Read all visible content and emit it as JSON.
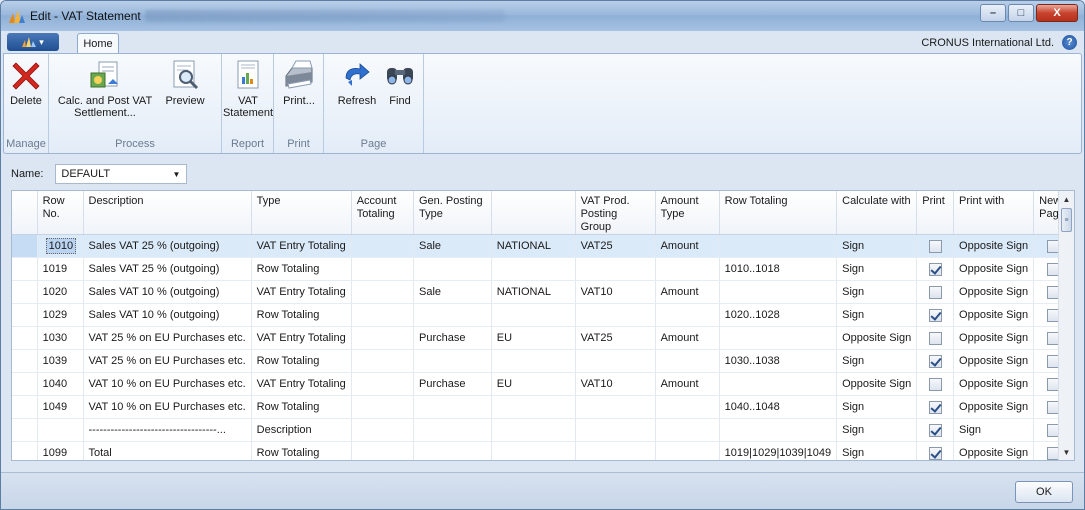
{
  "window": {
    "title": "Edit - VAT Statement",
    "min": "–",
    "max": "□",
    "close": "X"
  },
  "ribbon": {
    "app_button": "▾",
    "tab_home": "Home",
    "company": "CRONUS International Ltd.",
    "help": "?",
    "groups": {
      "manage": "Manage",
      "process": "Process",
      "report": "Report",
      "print": "Print",
      "page": "Page"
    },
    "buttons": {
      "delete": "Delete",
      "calc_post_1": "Calc. and Post VAT",
      "calc_post_2": "Settlement...",
      "preview": "Preview",
      "vat_statement_1": "VAT",
      "vat_statement_2": "Statement",
      "print": "Print...",
      "refresh": "Refresh",
      "find": "Find"
    }
  },
  "name_field": {
    "label": "Name:",
    "value": "DEFAULT"
  },
  "grid": {
    "headers": [
      "Row No.",
      "Description",
      "Type",
      "Account Totaling",
      "Gen. Posting Type",
      "",
      "VAT Prod. Posting Group",
      "Amount Type",
      "Row Totaling",
      "Calculate with",
      "Print",
      "Print with",
      "New Page"
    ],
    "rows": [
      {
        "row_no": "1010",
        "description": "Sales VAT 25 % (outgoing)",
        "type": "VAT Entry Totaling",
        "account_totaling": "",
        "gen_posting_type": "Sale",
        "bus_posting_group": "NATIONAL",
        "vat_prod_group": "VAT25",
        "amount_type": "Amount",
        "row_totaling": "",
        "calculate_with": "Sign",
        "print": false,
        "print_with": "Opposite Sign",
        "new_page": false
      },
      {
        "row_no": "1019",
        "description": "Sales VAT 25 % (outgoing)",
        "type": "Row Totaling",
        "account_totaling": "",
        "gen_posting_type": "",
        "bus_posting_group": "",
        "vat_prod_group": "",
        "amount_type": "",
        "row_totaling": "1010..1018",
        "calculate_with": "Sign",
        "print": true,
        "print_with": "Opposite Sign",
        "new_page": false
      },
      {
        "row_no": "1020",
        "description": "Sales VAT 10 % (outgoing)",
        "type": "VAT Entry Totaling",
        "account_totaling": "",
        "gen_posting_type": "Sale",
        "bus_posting_group": "NATIONAL",
        "vat_prod_group": "VAT10",
        "amount_type": "Amount",
        "row_totaling": "",
        "calculate_with": "Sign",
        "print": false,
        "print_with": "Opposite Sign",
        "new_page": false
      },
      {
        "row_no": "1029",
        "description": "Sales VAT 10 % (outgoing)",
        "type": "Row Totaling",
        "account_totaling": "",
        "gen_posting_type": "",
        "bus_posting_group": "",
        "vat_prod_group": "",
        "amount_type": "",
        "row_totaling": "1020..1028",
        "calculate_with": "Sign",
        "print": true,
        "print_with": "Opposite Sign",
        "new_page": false
      },
      {
        "row_no": "1030",
        "description": "VAT 25 % on EU Purchases etc.",
        "type": "VAT Entry Totaling",
        "account_totaling": "",
        "gen_posting_type": "Purchase",
        "bus_posting_group": "EU",
        "vat_prod_group": "VAT25",
        "amount_type": "Amount",
        "row_totaling": "",
        "calculate_with": "Opposite Sign",
        "print": false,
        "print_with": "Opposite Sign",
        "new_page": false
      },
      {
        "row_no": "1039",
        "description": "VAT 25 % on EU Purchases etc.",
        "type": "Row Totaling",
        "account_totaling": "",
        "gen_posting_type": "",
        "bus_posting_group": "",
        "vat_prod_group": "",
        "amount_type": "",
        "row_totaling": "1030..1038",
        "calculate_with": "Sign",
        "print": true,
        "print_with": "Opposite Sign",
        "new_page": false
      },
      {
        "row_no": "1040",
        "description": "VAT 10 % on EU Purchases etc.",
        "type": "VAT Entry Totaling",
        "account_totaling": "",
        "gen_posting_type": "Purchase",
        "bus_posting_group": "EU",
        "vat_prod_group": "VAT10",
        "amount_type": "Amount",
        "row_totaling": "",
        "calculate_with": "Opposite Sign",
        "print": false,
        "print_with": "Opposite Sign",
        "new_page": false
      },
      {
        "row_no": "1049",
        "description": "VAT 10 % on EU Purchases etc.",
        "type": "Row Totaling",
        "account_totaling": "",
        "gen_posting_type": "",
        "bus_posting_group": "",
        "vat_prod_group": "",
        "amount_type": "",
        "row_totaling": "1040..1048",
        "calculate_with": "Sign",
        "print": true,
        "print_with": "Opposite Sign",
        "new_page": false
      },
      {
        "row_no": "",
        "description": "-----------------------------------...",
        "type": "Description",
        "account_totaling": "",
        "gen_posting_type": "",
        "bus_posting_group": "",
        "vat_prod_group": "",
        "amount_type": "",
        "row_totaling": "",
        "calculate_with": "Sign",
        "print": true,
        "print_with": "Sign",
        "new_page": false
      },
      {
        "row_no": "1099",
        "description": "Total",
        "type": "Row Totaling",
        "account_totaling": "",
        "gen_posting_type": "",
        "bus_posting_group": "",
        "vat_prod_group": "",
        "amount_type": "",
        "row_totaling": "1019|1029|1039|1049",
        "calculate_with": "Sign",
        "print": true,
        "print_with": "Opposite Sign",
        "new_page": false
      }
    ],
    "selected_row": 0,
    "scroll_up": "▲",
    "scroll_down": "▼",
    "scroll_grip": "≡"
  },
  "footer": {
    "ok": "OK"
  },
  "icons": {
    "app": "dynamics-nav-icon",
    "delete": "red-x-icon",
    "calc_post": "post-document-icon",
    "preview": "preview-magnifier-icon",
    "vat_statement": "report-chart-icon",
    "print": "printer-icon",
    "refresh": "refresh-arrow-icon",
    "find": "binoculars-icon"
  },
  "colors": {
    "selected_row": "#dbeaf9",
    "delete_red": "#d4271f"
  }
}
